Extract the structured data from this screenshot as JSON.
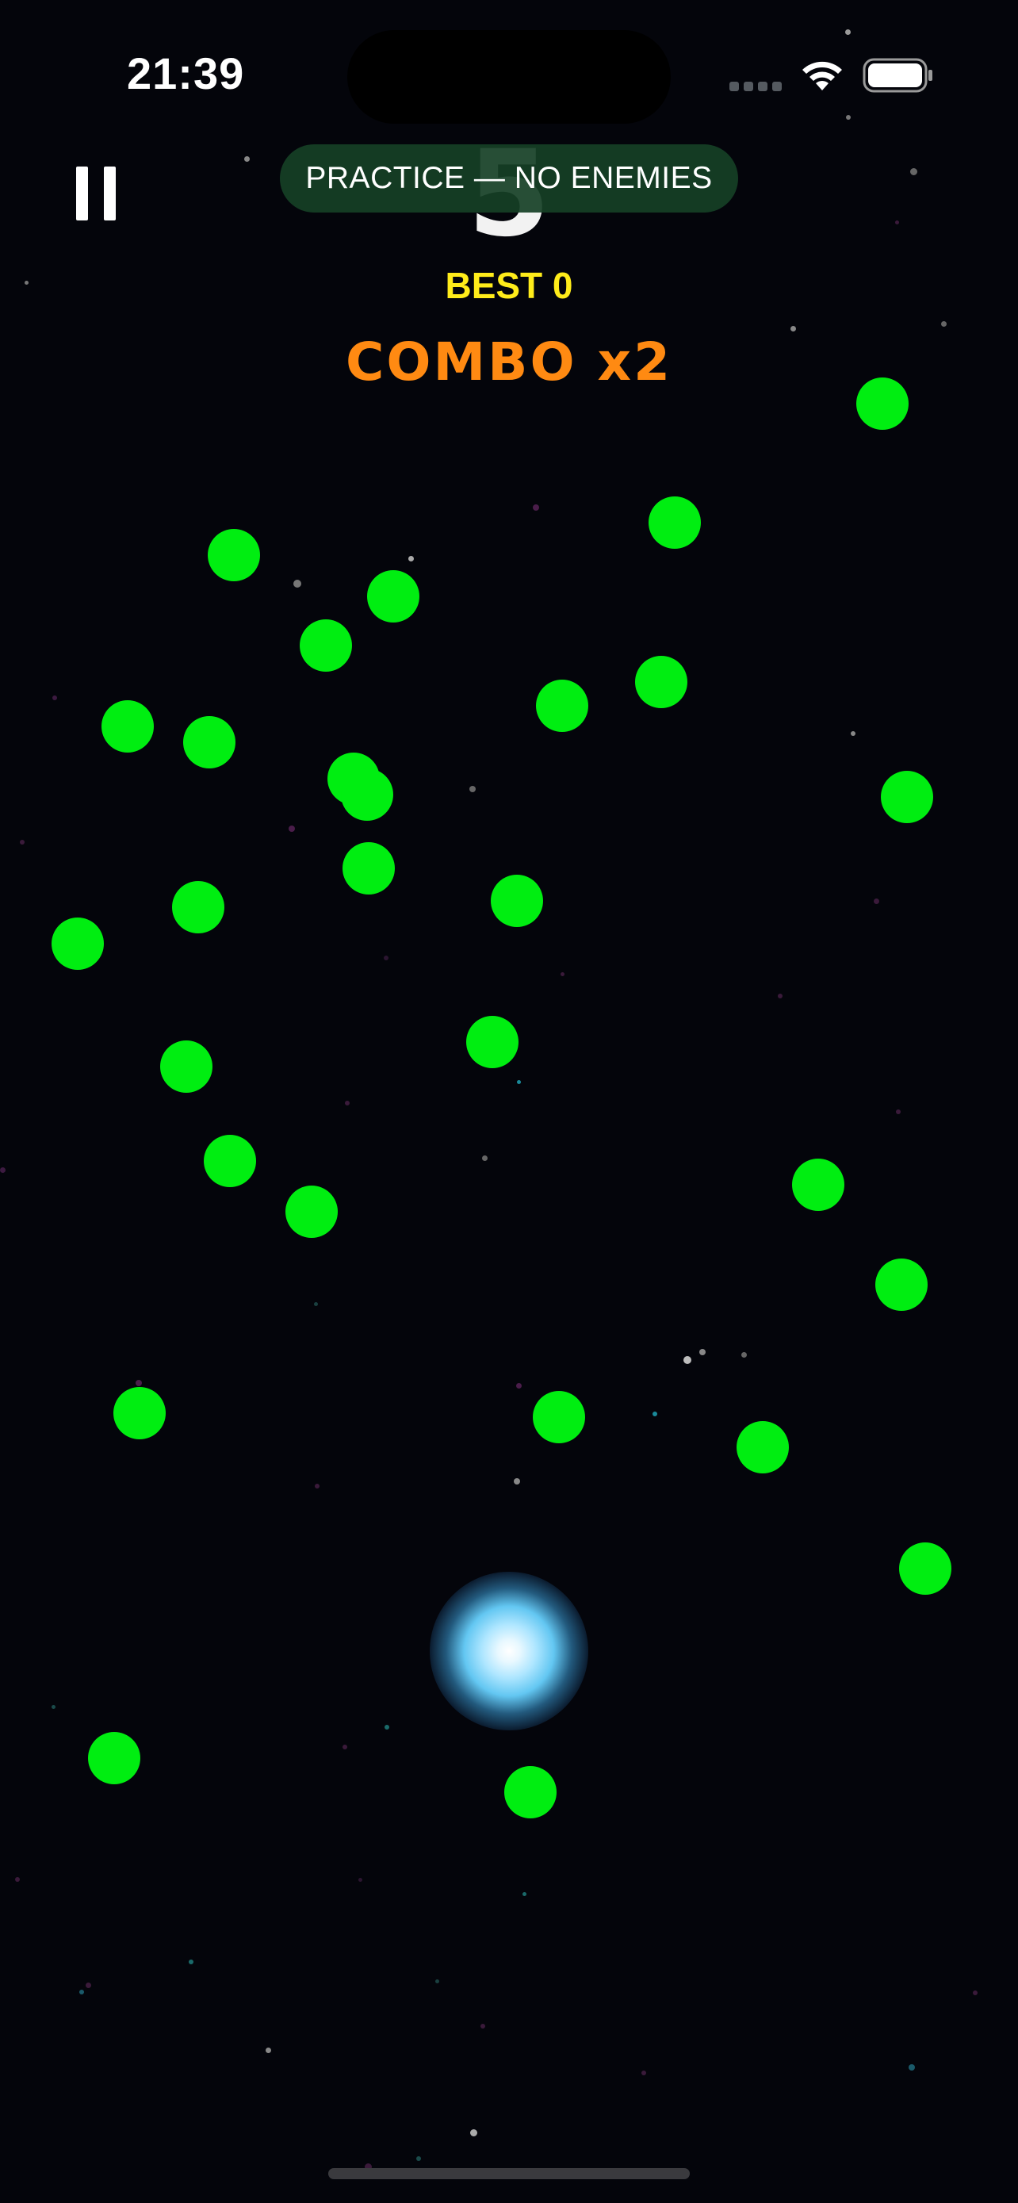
{
  "status_bar": {
    "time": "21:39",
    "signal_icon": "cellular-signal-icon",
    "wifi_icon": "wifi-icon",
    "battery_icon": "battery-full-icon"
  },
  "hud": {
    "pause_icon": "pause-icon",
    "score": "5",
    "mode_label": "PRACTICE — NO ENEMIES",
    "best_label": "BEST 0",
    "combo_label": "COMBO x2"
  },
  "game": {
    "orb_count": 32,
    "player": "glowing-blue-orb"
  },
  "colors": {
    "background": "#04050b",
    "orb": "#00ee11",
    "best": "#ffec1a",
    "combo": "#ff8a12",
    "pill": "#164026",
    "player_glow": "#63c7f2"
  }
}
